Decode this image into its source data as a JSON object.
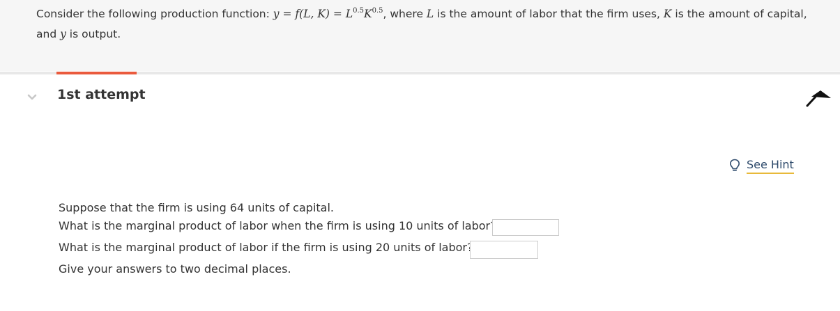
{
  "prompt": {
    "intro": "Consider the following production function: ",
    "y": "y",
    "eq1": " = ",
    "f": "f",
    "args": "(L, K)",
    "eq2": " = ",
    "L": "L",
    "exp_L": "0.5",
    "K": "K",
    "exp_K": "0.5",
    "mid1": ", where ",
    "L2": "L",
    "mid2": " is the amount of labor that the firm uses, ",
    "K2": "K",
    "mid3": " is the amount of capital,",
    "line2_pre": "and ",
    "y2": "y",
    "line2_post": " is output."
  },
  "attempt": {
    "title": "1st attempt"
  },
  "hint": {
    "label": "See Hint",
    "icon": "lightbulb-icon"
  },
  "question": {
    "line1": "Suppose that the firm is using 64 units of capital.",
    "line2": "What is the marginal product of labor when the firm is using 10 units of labor?",
    "line3": "What is the marginal product of labor if the firm is using 20 units of labor?",
    "line4": "Give your answers to two decimal places.",
    "answer1_value": "",
    "answer2_value": ""
  },
  "colors": {
    "accent_tab": "#ea5a3d",
    "hint_underline": "#e8b93a",
    "header_bg": "#f6f6f6"
  }
}
